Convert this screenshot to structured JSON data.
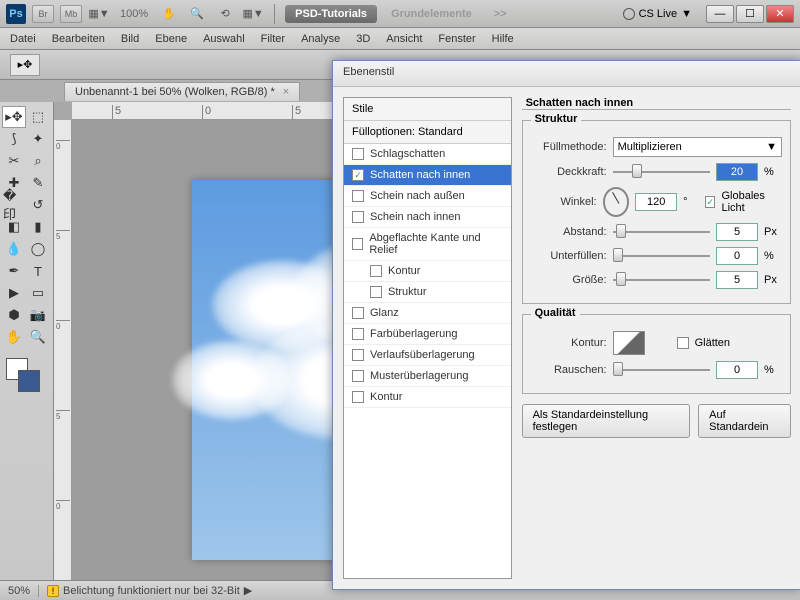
{
  "top": {
    "zoom": "100%",
    "psd_btn": "PSD-Tutorials",
    "grund_btn": "Grundelemente",
    "cslive": "CS Live",
    "arrows": ">>",
    "down": "▼"
  },
  "menu": [
    "Datei",
    "Bearbeiten",
    "Bild",
    "Ebene",
    "Auswahl",
    "Filter",
    "Analyse",
    "3D",
    "Ansicht",
    "Fenster",
    "Hilfe"
  ],
  "doc_tab": "Unbenannt-1 bei 50% (Wolken, RGB/8) *",
  "ruler_h": [
    "5",
    "0",
    "5"
  ],
  "ruler_v": [
    "0",
    "5",
    "0",
    "5",
    "0"
  ],
  "status": {
    "zoom": "50%",
    "info": "Belichtung funktioniert nur bei 32-Bit",
    "tri": "▶"
  },
  "dlg": {
    "title": "Ebenenstil",
    "styles_header": "Stile",
    "fill_header": "Fülloptionen: Standard",
    "rows": [
      {
        "label": "Schlagschatten",
        "checked": false
      },
      {
        "label": "Schatten nach innen",
        "checked": true,
        "active": true
      },
      {
        "label": "Schein nach außen",
        "checked": false
      },
      {
        "label": "Schein nach innen",
        "checked": false
      },
      {
        "label": "Abgeflachte Kante und Relief",
        "checked": false
      },
      {
        "label": "Kontur",
        "checked": false,
        "indent": true
      },
      {
        "label": "Struktur",
        "checked": false,
        "indent": true
      },
      {
        "label": "Glanz",
        "checked": false
      },
      {
        "label": "Farbüberlagerung",
        "checked": false
      },
      {
        "label": "Verlaufsüberlagerung",
        "checked": false
      },
      {
        "label": "Musterüberlagerung",
        "checked": false
      },
      {
        "label": "Kontur",
        "checked": false
      }
    ],
    "panel_title": "Schatten nach innen",
    "struktur": "Struktur",
    "fullmethode": "Füllmethode:",
    "fullmethode_val": "Multiplizieren",
    "deckkraft": "Deckkraft:",
    "deckkraft_val": "20",
    "winkel": "Winkel:",
    "winkel_val": "120",
    "globales": "Globales Licht",
    "abstand": "Abstand:",
    "abstand_val": "5",
    "unterfullen": "Unterfüllen:",
    "unterfullen_val": "0",
    "grosse": "Größe:",
    "grosse_val": "5",
    "qualitat": "Qualität",
    "kontur": "Kontur:",
    "glatten": "Glätten",
    "rauschen": "Rauschen:",
    "rauschen_val": "0",
    "pct": "%",
    "px": "Px",
    "deg": "°",
    "dd": "▼",
    "btn_default": "Als Standardeinstellung festlegen",
    "btn_reset": "Auf Standardein"
  }
}
